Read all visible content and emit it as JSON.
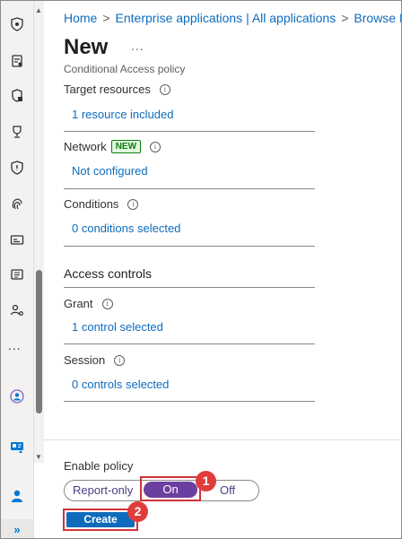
{
  "breadcrumb": {
    "items": [
      "Home",
      "Enterprise applications | All applications",
      "Browse M"
    ],
    "separator": ">"
  },
  "page": {
    "title": "New",
    "more": "...",
    "subtitle": "Conditional Access policy"
  },
  "assignments": {
    "target_resources": {
      "label": "Target resources",
      "value": "1 resource included"
    },
    "network": {
      "label": "Network",
      "badge": "NEW",
      "value": "Not configured"
    },
    "conditions": {
      "label": "Conditions",
      "value": "0 conditions selected"
    }
  },
  "access_controls": {
    "heading": "Access controls",
    "grant": {
      "label": "Grant",
      "value": "1 control selected"
    },
    "session": {
      "label": "Session",
      "value": "0 controls selected"
    }
  },
  "footer": {
    "enable_label": "Enable policy",
    "options": [
      "Report-only",
      "On",
      "Off"
    ],
    "selected": "On",
    "create_label": "Create"
  },
  "steps": [
    "1",
    "2"
  ],
  "rail": {
    "icons": [
      "shield-lock-icon",
      "document-check-icon",
      "shield-lock-alt-icon",
      "trophy-icon",
      "shield-icon",
      "fingerprint-icon",
      "id-card-icon",
      "notes-icon",
      "people-settings-icon",
      "more-icon",
      "identity-circle-icon",
      "identity-card-icon",
      "user-icon",
      "expand-icon"
    ],
    "more": "...",
    "expand": "»"
  },
  "colors": {
    "accent": "#0f6cbd",
    "toggle_selected": "#6b3fa0",
    "highlight": "#d13438",
    "badge_green": "#107c10"
  }
}
